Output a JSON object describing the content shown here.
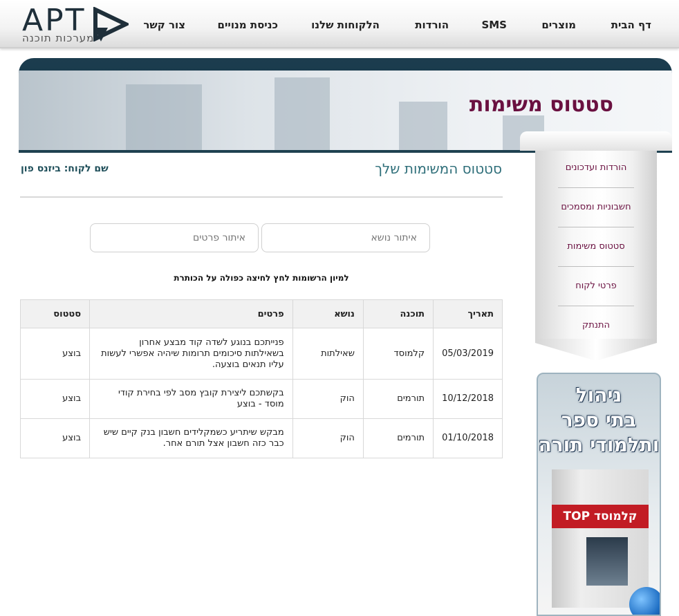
{
  "logo": {
    "text": "APT",
    "tagline": "מערכות תוכנה"
  },
  "nav": {
    "items": [
      {
        "label": "דף הבית"
      },
      {
        "label": "מוצרים"
      },
      {
        "label": "SMS"
      },
      {
        "label": "הורדות"
      },
      {
        "label": "הלקוחות שלנו"
      },
      {
        "label": "כניסת מנויים"
      },
      {
        "label": "צור קשר"
      }
    ]
  },
  "banner": {
    "title": "סטטוס משימות"
  },
  "sidebar": {
    "items": [
      {
        "label": "הורדות ועדכונים"
      },
      {
        "label": "חשבוניות ומסמכים"
      },
      {
        "label": "סטטוס משימות"
      },
      {
        "label": "פרטי לקוח"
      },
      {
        "label": "התנתק"
      }
    ]
  },
  "ad": {
    "lines": [
      "ניהול",
      "בתי ספר",
      "ותלמודי תורה"
    ],
    "product": "קלמוסד TOP"
  },
  "main": {
    "heading": "סטטוס המשימות שלך",
    "customer_label": "שם לקוח: ביזנס פון",
    "filter_subject_placeholder": "איתור נושא",
    "filter_details_placeholder": "איתור פרטים",
    "sort_hint": "למיון הרשומות לחץ לחיצה כפולה על הכותרת"
  },
  "table": {
    "headers": [
      "תאריך",
      "תוכנה",
      "נושא",
      "פרטים",
      "סטטוס"
    ],
    "rows": [
      {
        "date": "05/03/2019",
        "software": "קלמוסד",
        "subject": "שאילתות",
        "details": "פנייתכם בנוגע לשדה קוד מבצע אחרון בשאילתות סיכומים תרומות שיהיה אפשרי לעשות עליו תנאים בוצעה.",
        "status": "בוצע"
      },
      {
        "date": "10/12/2018",
        "software": "תורמים",
        "subject": "הוק",
        "details": "בקשתכם ליצירת קובץ מסב לפי בחירת קודי מוסד - בוצע",
        "status": "בוצע"
      },
      {
        "date": "01/10/2018",
        "software": "תורמים",
        "subject": "הוק",
        "details": "מבקש שיתריע כשמקלידים חשבון בנק קיים שיש כבר כזה חשבון אצל תורם אחר.",
        "status": "בוצע"
      }
    ]
  },
  "colors": {
    "brand_dark": "#1c3d4f",
    "accent_maroon": "#6a1040",
    "heading_teal": "#2f6f7a"
  }
}
